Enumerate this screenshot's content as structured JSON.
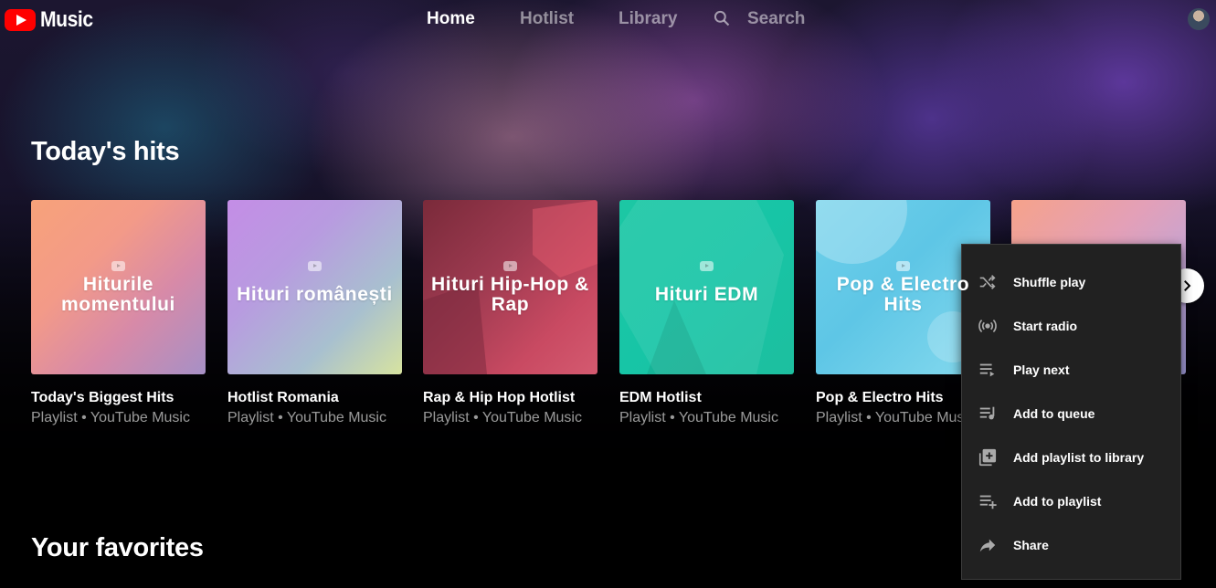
{
  "app": {
    "logo_text": "Music"
  },
  "nav": {
    "home": "Home",
    "hotlist": "Hotlist",
    "library": "Library",
    "search": "Search"
  },
  "sections": {
    "todays_hits": "Today's hits",
    "your_favorites": "Your favorites"
  },
  "cards": [
    {
      "art_title": "Hiturile momentului",
      "name": "Today's Biggest Hits",
      "subtitle": "Playlist • YouTube Music"
    },
    {
      "art_title": "Hituri românești",
      "name": "Hotlist Romania",
      "subtitle": "Playlist • YouTube Music"
    },
    {
      "art_title": "Hituri Hip-Hop & Rap",
      "name": "Rap & Hip Hop Hotlist",
      "subtitle": "Playlist • YouTube Music"
    },
    {
      "art_title": "Hituri EDM",
      "name": "EDM Hotlist",
      "subtitle": "Playlist • YouTube Music"
    },
    {
      "art_title": "Pop & Electro Hits",
      "name": "Pop & Electro Hits",
      "subtitle": "Playlist • YouTube Music"
    }
  ],
  "context_menu": [
    {
      "label": "Shuffle play",
      "icon": "shuffle-icon"
    },
    {
      "label": "Start radio",
      "icon": "radio-icon"
    },
    {
      "label": "Play next",
      "icon": "play-next-icon"
    },
    {
      "label": "Add to queue",
      "icon": "queue-icon"
    },
    {
      "label": "Add playlist to library",
      "icon": "library-add-icon"
    },
    {
      "label": "Add to playlist",
      "icon": "playlist-add-icon"
    },
    {
      "label": "Share",
      "icon": "share-icon"
    }
  ],
  "colors": {
    "brand_red": "#ff0000",
    "menu_bg": "#212121"
  }
}
